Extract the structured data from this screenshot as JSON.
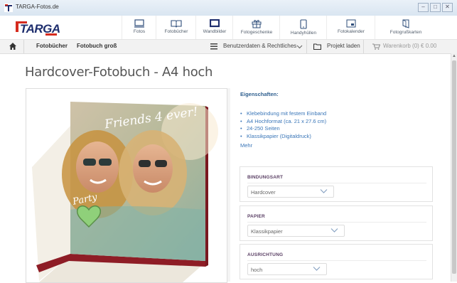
{
  "window": {
    "title": "TARGA-Fotos.de",
    "buttons": [
      "–",
      "□",
      "✕"
    ]
  },
  "logo": {
    "text": "TARGA"
  },
  "nav": [
    {
      "label": "Fotos",
      "icon": "photo-icon"
    },
    {
      "label": "Fotobücher",
      "icon": "photobook-icon"
    },
    {
      "label": "Wandbilder",
      "icon": "wall-picture-icon"
    },
    {
      "label": "Fotogeschenke",
      "icon": "gift-icon"
    },
    {
      "label": "Handyhüllen",
      "icon": "phone-icon"
    },
    {
      "label": "Fotokalender",
      "icon": "calendar-icon"
    },
    {
      "label": "Fotogrußkarten",
      "icon": "greeting-card-icon"
    }
  ],
  "subnav": {
    "crumbs": [
      "Fotobücher",
      "Fotobuch groß"
    ],
    "user_data": "Benutzerdaten & Rechtliches",
    "load_project": "Projekt laden",
    "cart": "Warenkorb (0) € 0.00"
  },
  "product": {
    "title": "Hardcover-Fotobuch - A4 hoch",
    "cover_text": "Friends 4 ever!",
    "cover_text2": "Party"
  },
  "properties": {
    "title": "Eigenschaften:",
    "items": [
      "Klebebindung mit festem Einband",
      "A4 Hochformat (ca. 21 x 27.6 cm)",
      "24-250 Seiten",
      "Klassikpapier (Digitaldruck)"
    ],
    "more": "Mehr"
  },
  "options": [
    {
      "label": "BINDUNGSART",
      "value": "Hardcover"
    },
    {
      "label": "PAPIER",
      "value": "Klassikpapier"
    },
    {
      "label": "AUSRICHTUNG",
      "value": "hoch"
    }
  ],
  "colors": {
    "brand_blue": "#1e2e6e",
    "brand_red": "#d52b1e",
    "link": "#3a76b8"
  }
}
